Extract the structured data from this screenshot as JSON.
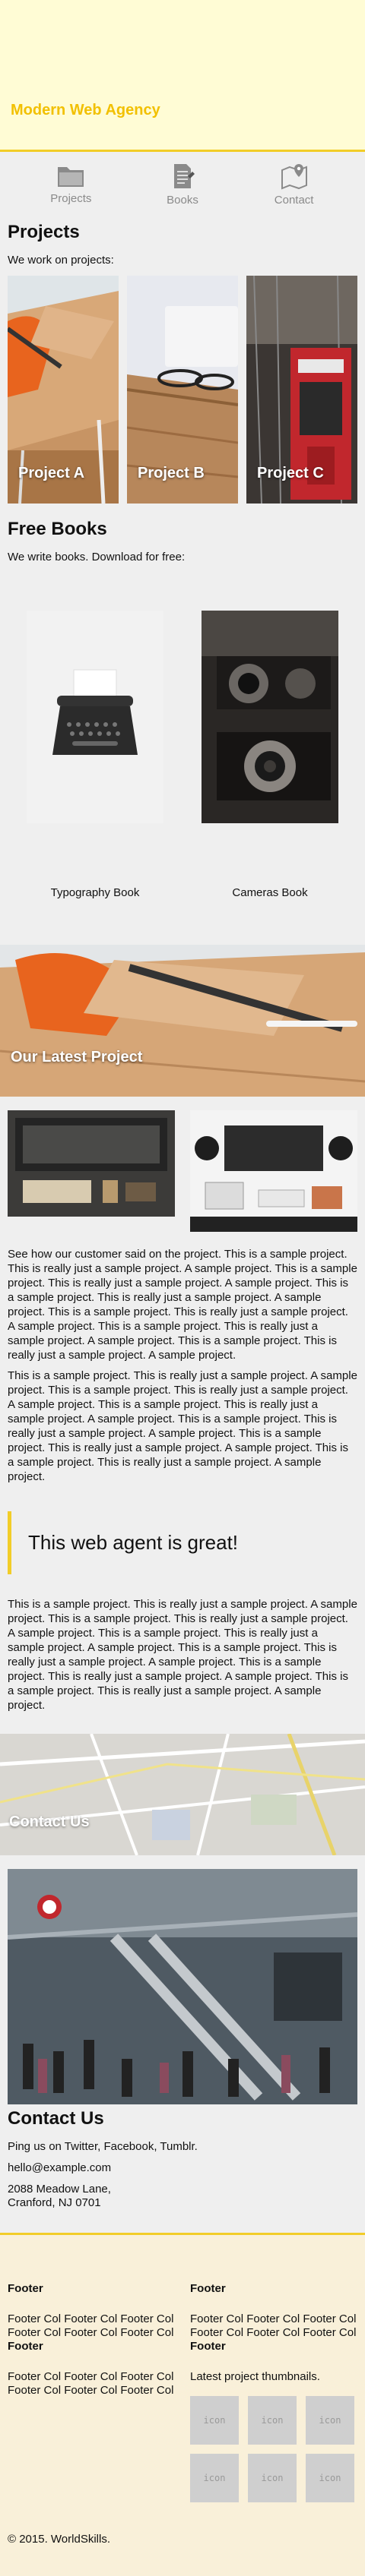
{
  "header": {
    "brand": "Modern Web Agency"
  },
  "nav": {
    "items": [
      {
        "label": "Projects",
        "icon": "folder-icon"
      },
      {
        "label": "Books",
        "icon": "document-icon"
      },
      {
        "label": "Contact",
        "icon": "map-pin-icon"
      }
    ]
  },
  "projects": {
    "heading": "Projects",
    "intro": "We work on projects:",
    "cards": [
      {
        "caption": "Project A"
      },
      {
        "caption": "Project B"
      },
      {
        "caption": "Project C"
      }
    ]
  },
  "books": {
    "heading": "Free Books",
    "intro": "We write books. Download for free:",
    "items": [
      {
        "title": "Typography Book"
      },
      {
        "title": "Cameras Book"
      }
    ]
  },
  "latest": {
    "banner_caption": "Our Latest Project",
    "paragraph1": "See how our customer said on the project. This is a sample project. This is really just a sample project. A sample project. This is a sample project. This is really just a sample project. A sample project. This is a sample project. This is really just a sample project. A sample project. This is a sample project. This is really just a sample project. A sample project. This is a sample project. This is really just a sample project. A sample project. This is a sample project. This is really just a sample project. A sample project.",
    "paragraph2": "This is a sample project. This is really just a sample project. A sample project. This is a sample project. This is really just a sample project. A sample project. This is a sample project. This is really just a sample project. A sample project. This is a sample project. This is really just a sample project. A sample project. This is a sample project. This is really just a sample project. A sample project. This is a sample project. This is really just a sample project. A sample project.",
    "quote": "This web agent is great!",
    "paragraph3": "This is a sample project. This is really just a sample project. A sample project. This is a sample project. This is really just a sample project. A sample project. This is a sample project. This is really just a sample project. A sample project. This is a sample project. This is really just a sample project. A sample project. This is a sample project. This is really just a sample project. A sample project. This is a sample project. This is really just a sample project. A sample project."
  },
  "contact": {
    "map_caption": "Contact Us",
    "heading": "Contact Us",
    "social": "Ping us on Twitter, Facebook, Tumblr.",
    "email": "hello@example.com",
    "address_line1": "2088 Meadow Lane,",
    "address_line2": "Cranford, NJ 0701"
  },
  "footer": {
    "col1_heading": "Footer",
    "col1_text1": "Footer Col Footer Col Footer Col Footer Col Footer Col Footer Col",
    "col1_heading2": "Footer",
    "col1_text2": "Footer Col Footer Col Footer Col Footer Col Footer Col Footer Col",
    "col2_heading": "Footer",
    "col2_text": "Footer Col Footer Col Footer Col Footer Col Footer Col Footer Col",
    "col2_heading2": "Footer",
    "col2_text2": "Latest project thumbnails.",
    "thumb_label": "icon",
    "copyright": "© 2015. WorldSkills."
  },
  "colors": {
    "accent": "#f2cd28",
    "brand": "#f2c000",
    "hero_bg": "#fffcd5",
    "footer_bg": "#f9f0d9",
    "page_bg": "#efefef"
  }
}
